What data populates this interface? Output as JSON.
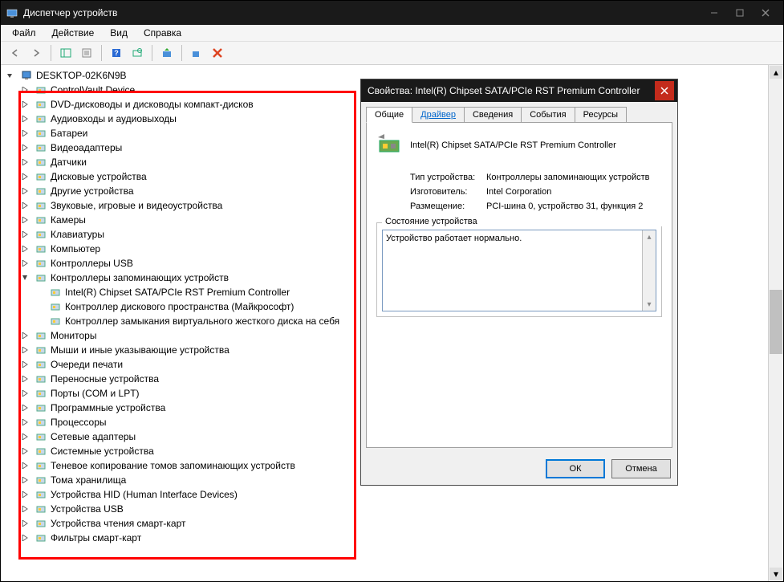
{
  "title": "Диспетчер устройств",
  "menu": {
    "file": "Файл",
    "action": "Действие",
    "view": "Вид",
    "help": "Справка"
  },
  "root": "DESKTOP-02K6N9B",
  "categories": [
    {
      "label": "ControlVault Device"
    },
    {
      "label": "DVD-дисководы и дисководы компакт-дисков"
    },
    {
      "label": "Аудиовходы и аудиовыходы"
    },
    {
      "label": "Батареи"
    },
    {
      "label": "Видеоадаптеры"
    },
    {
      "label": "Датчики"
    },
    {
      "label": "Дисковые устройства"
    },
    {
      "label": "Другие устройства"
    },
    {
      "label": "Звуковые, игровые и видеоустройства"
    },
    {
      "label": "Камеры"
    },
    {
      "label": "Клавиатуры"
    },
    {
      "label": "Компьютер"
    },
    {
      "label": "Контроллеры USB"
    },
    {
      "label": "Контроллеры запоминающих устройств",
      "expanded": true,
      "children": [
        {
          "label": "Intel(R) Chipset SATA/PCIe RST Premium Controller"
        },
        {
          "label": "Контроллер дискового пространства (Майкрософт)"
        },
        {
          "label": "Контроллер замыкания виртуального жесткого диска на себя"
        }
      ]
    },
    {
      "label": "Мониторы"
    },
    {
      "label": "Мыши и иные указывающие устройства"
    },
    {
      "label": "Очереди печати"
    },
    {
      "label": "Переносные устройства"
    },
    {
      "label": "Порты (COM и LPT)"
    },
    {
      "label": "Программные устройства"
    },
    {
      "label": "Процессоры"
    },
    {
      "label": "Сетевые адаптеры"
    },
    {
      "label": "Системные устройства"
    },
    {
      "label": "Теневое копирование томов запоминающих устройств"
    },
    {
      "label": "Тома хранилища"
    },
    {
      "label": "Устройства HID (Human Interface Devices)"
    },
    {
      "label": "Устройства USB"
    },
    {
      "label": "Устройства чтения смарт-карт"
    },
    {
      "label": "Фильтры смарт-карт"
    }
  ],
  "dialog": {
    "title": "Свойства: Intel(R) Chipset SATA/PCIe RST Premium Controller",
    "tabs": {
      "general": "Общие",
      "driver": "Драйвер",
      "details": "Сведения",
      "events": "События",
      "resources": "Ресурсы"
    },
    "device_name": "Intel(R) Chipset SATA/PCIe RST Premium Controller",
    "type_label": "Тип устройства:",
    "type_value": "Контроллеры запоминающих устройств",
    "mfr_label": "Изготовитель:",
    "mfr_value": "Intel Corporation",
    "loc_label": "Размещение:",
    "loc_value": "PCI-шина 0, устройство 31, функция 2",
    "status_legend": "Состояние устройства",
    "status_text": "Устройство работает нормально.",
    "ok": "ОК",
    "cancel": "Отмена"
  }
}
